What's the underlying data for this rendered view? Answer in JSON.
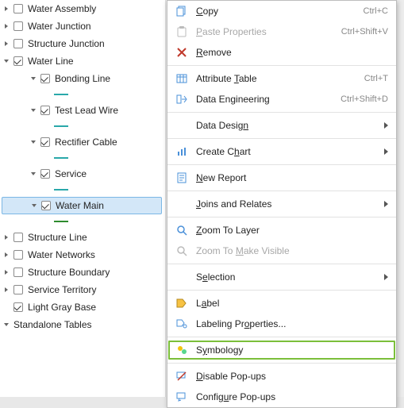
{
  "toc": {
    "items": [
      {
        "label": "Water Assembly",
        "level": 0,
        "collapsed": true,
        "checked": false
      },
      {
        "label": "Water Junction",
        "level": 0,
        "collapsed": true,
        "checked": false
      },
      {
        "label": "Structure Junction",
        "level": 0,
        "collapsed": true,
        "checked": false
      },
      {
        "label": "Water Line",
        "level": 0,
        "collapsed": false,
        "checked": true
      },
      {
        "label": "Bonding Line",
        "level": 1,
        "collapsed": false,
        "checked": true,
        "swatch": "teal"
      },
      {
        "label": "Test Lead Wire",
        "level": 1,
        "collapsed": false,
        "checked": true,
        "swatch": "teal"
      },
      {
        "label": "Rectifier Cable",
        "level": 1,
        "collapsed": false,
        "checked": true,
        "swatch": "teal"
      },
      {
        "label": "Service",
        "level": 1,
        "collapsed": false,
        "checked": true,
        "swatch": "teal"
      },
      {
        "label": "Water Main",
        "level": 1,
        "collapsed": false,
        "checked": true,
        "swatch": "green",
        "selected": true
      },
      {
        "label": "Structure Line",
        "level": 0,
        "collapsed": true,
        "checked": false
      },
      {
        "label": "Water Networks",
        "level": 0,
        "collapsed": true,
        "checked": false
      },
      {
        "label": "Structure Boundary",
        "level": 0,
        "collapsed": true,
        "checked": false
      },
      {
        "label": "Service Territory",
        "level": 0,
        "collapsed": true,
        "checked": false
      },
      {
        "label": "Light Gray Base",
        "level": 0,
        "checked": true,
        "notwisty": true
      },
      {
        "label": "Standalone Tables",
        "level": 0,
        "collapsed": false,
        "nocheck": true
      }
    ]
  },
  "menu": {
    "items": [
      {
        "icon": "copy",
        "html": "<u>C</u>opy",
        "plain": "Copy",
        "shortcut": "Ctrl+C"
      },
      {
        "icon": "paste",
        "html": "<u>P</u>aste Properties",
        "plain": "Paste Properties",
        "shortcut": "Ctrl+Shift+V",
        "disabled": true
      },
      {
        "icon": "remove",
        "html": "<u>R</u>emove",
        "plain": "Remove"
      },
      {
        "sep": true
      },
      {
        "icon": "table",
        "html": "Attribute <u>T</u>able",
        "plain": "Attribute Table",
        "shortcut": "Ctrl+T"
      },
      {
        "icon": "dataeng",
        "html": "Data Engineering",
        "plain": "Data Engineering",
        "shortcut": "Ctrl+Shift+D"
      },
      {
        "sep": true
      },
      {
        "icon": "",
        "html": "Data Desig<u>n</u>",
        "plain": "Data Design",
        "sub": true
      },
      {
        "sep": true
      },
      {
        "icon": "chart",
        "html": "Create C<u>h</u>art",
        "plain": "Create Chart",
        "sub": true
      },
      {
        "sep": true
      },
      {
        "icon": "report",
        "html": "<u>N</u>ew Report",
        "plain": "New Report"
      },
      {
        "sep": true
      },
      {
        "icon": "",
        "html": "<u>J</u>oins and Relates",
        "plain": "Joins and Relates",
        "sub": true
      },
      {
        "sep": true
      },
      {
        "icon": "zoomto",
        "html": "<u>Z</u>oom To Layer",
        "plain": "Zoom To Layer"
      },
      {
        "icon": "zoomvis",
        "html": "Zoom To <u>M</u>ake Visible",
        "plain": "Zoom To Make Visible",
        "disabled": true
      },
      {
        "sep": true
      },
      {
        "icon": "",
        "html": "S<u>e</u>lection",
        "plain": "Selection",
        "sub": true
      },
      {
        "sep": true
      },
      {
        "icon": "label",
        "html": "L<u>a</u>bel",
        "plain": "Label"
      },
      {
        "icon": "labelprop",
        "html": "Labeling Pr<u>o</u>perties...",
        "plain": "Labeling Properties..."
      },
      {
        "sep": true
      },
      {
        "icon": "symbology",
        "html": "S<u>y</u>mbology",
        "plain": "Symbology",
        "highlight": true
      },
      {
        "sep": true
      },
      {
        "icon": "popoff",
        "html": "<u>D</u>isable Pop-ups",
        "plain": "Disable Pop-ups"
      },
      {
        "icon": "popcfg",
        "html": "Config<u>u</u>re Pop-ups",
        "plain": "Configure Pop-ups"
      }
    ]
  }
}
